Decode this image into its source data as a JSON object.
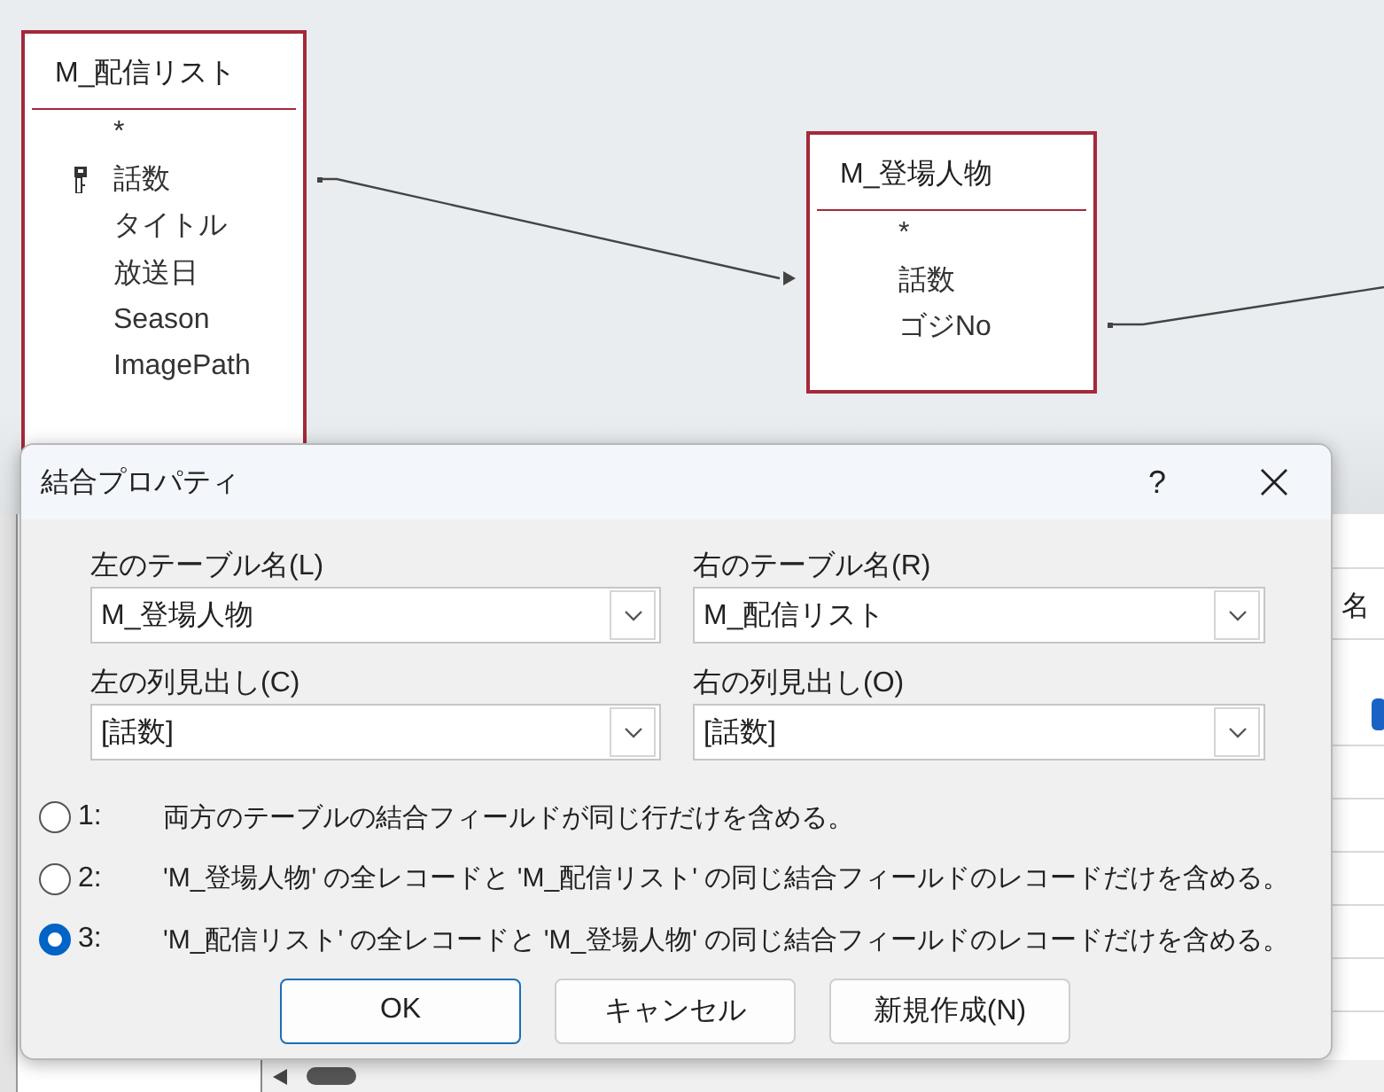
{
  "diagram": {
    "tables": [
      {
        "name": "M_配信リスト",
        "fields": [
          {
            "name": "*",
            "primary_key": false
          },
          {
            "name": "話数",
            "primary_key": true
          },
          {
            "name": "タイトル",
            "primary_key": false
          },
          {
            "name": "放送日",
            "primary_key": false
          },
          {
            "name": "Season",
            "primary_key": false
          },
          {
            "name": "ImagePath",
            "primary_key": false
          }
        ]
      },
      {
        "name": "M_登場人物",
        "fields": [
          {
            "name": "*",
            "primary_key": false
          },
          {
            "name": "話数",
            "primary_key": false
          },
          {
            "name": "ゴジNo",
            "primary_key": false
          }
        ]
      }
    ]
  },
  "background_pane": {
    "column_header": "名"
  },
  "dialog": {
    "title": "結合プロパティ",
    "help": "?",
    "left_table": {
      "label": "左のテーブル名(L)",
      "value": "M_登場人物"
    },
    "right_table": {
      "label": "右のテーブル名(R)",
      "value": "M_配信リスト"
    },
    "left_column": {
      "label": "左の列見出し(C)",
      "value": "[話数]"
    },
    "right_column": {
      "label": "右の列見出し(O)",
      "value": "[話数]"
    },
    "options": [
      {
        "number": "1:",
        "text": "両方のテーブルの結合フィールドが同じ行だけを含める。",
        "selected": false
      },
      {
        "number": "2:",
        "text": "'M_登場人物' の全レコードと 'M_配信リスト' の同じ結合フィールドのレコードだけを含める。",
        "selected": false
      },
      {
        "number": "3:",
        "text": "'M_配信リスト' の全レコードと 'M_登場人物' の同じ結合フィールドのレコードだけを含める。",
        "selected": true
      }
    ],
    "buttons": [
      {
        "label": "OK",
        "default": true
      },
      {
        "label": "キャンセル",
        "default": false
      },
      {
        "label": "新規作成(N)",
        "default": false
      }
    ]
  }
}
